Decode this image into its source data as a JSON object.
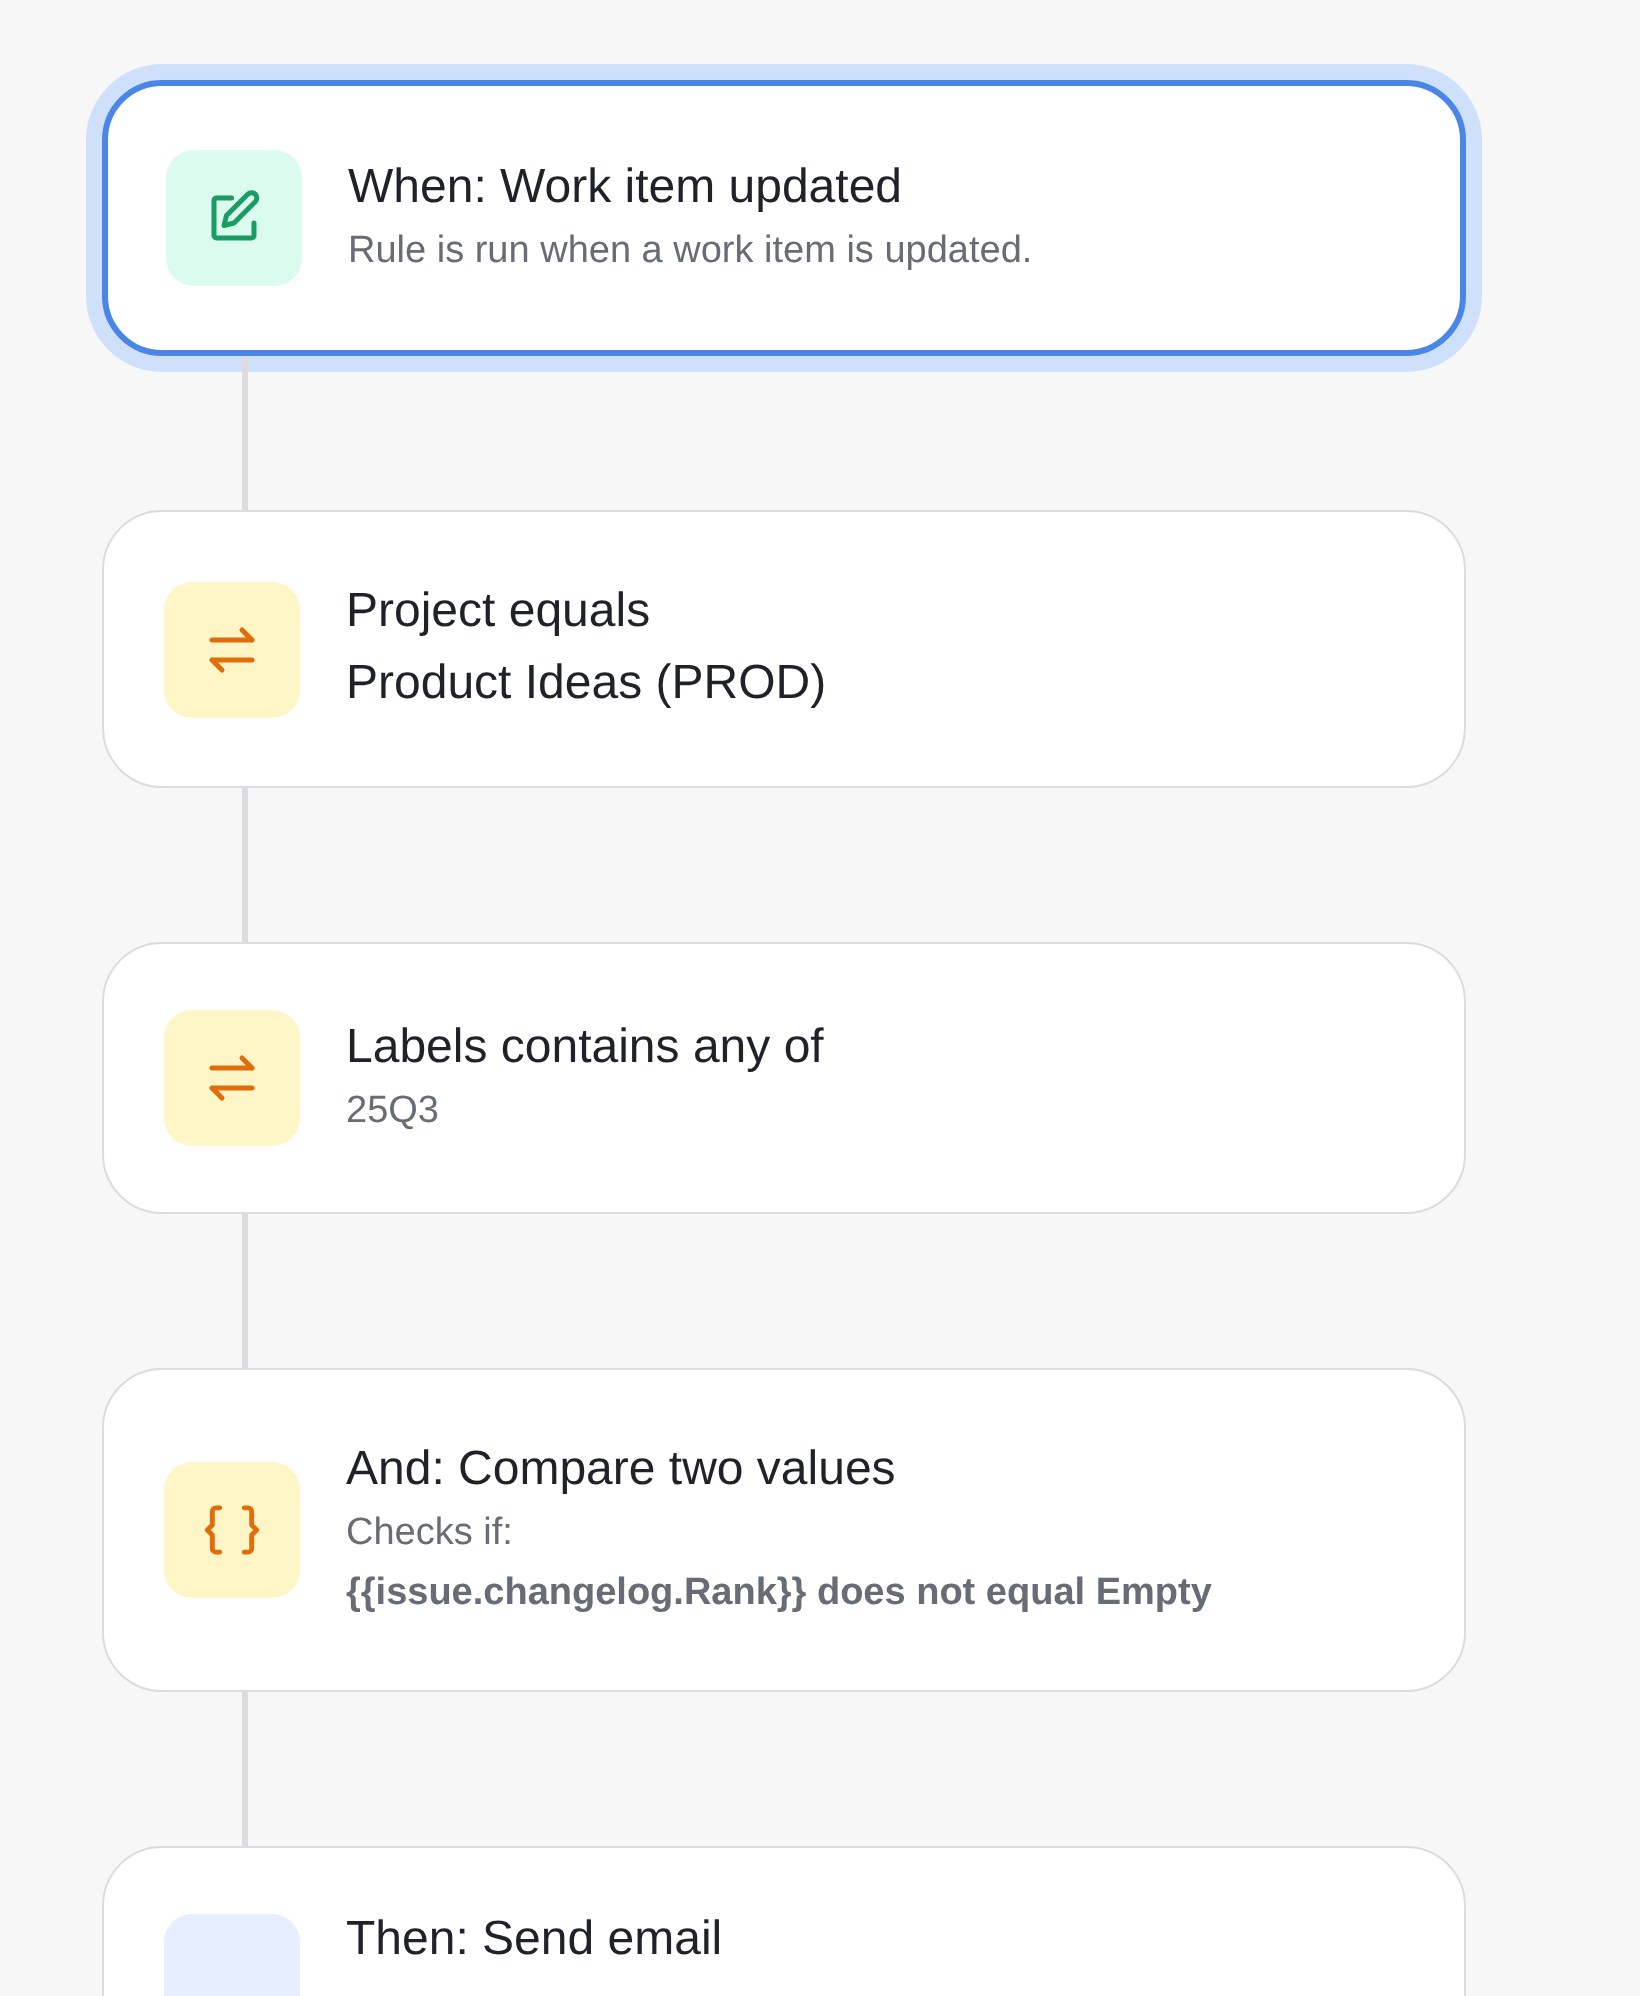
{
  "steps": [
    {
      "kind": "trigger",
      "selected": true,
      "title": "When: Work item updated",
      "lines": [
        {
          "kind": "desc",
          "text": "Rule is run when a work item is updated."
        }
      ]
    },
    {
      "kind": "condition",
      "selected": false,
      "title": "Project equals",
      "lines": [
        {
          "kind": "value",
          "text": "Product Ideas (PROD)"
        }
      ]
    },
    {
      "kind": "condition",
      "selected": false,
      "title": "Labels contains any of",
      "lines": [
        {
          "kind": "desc",
          "text": "25Q3"
        }
      ]
    },
    {
      "kind": "compare",
      "selected": false,
      "title": "And: Compare two values",
      "lines": [
        {
          "kind": "desc",
          "text": "Checks if:"
        },
        {
          "kind": "strong",
          "text": "{{issue.changelog.Rank}} does not equal Empty"
        }
      ]
    },
    {
      "kind": "action",
      "selected": false,
      "title": "Then: Send email"
    }
  ]
}
